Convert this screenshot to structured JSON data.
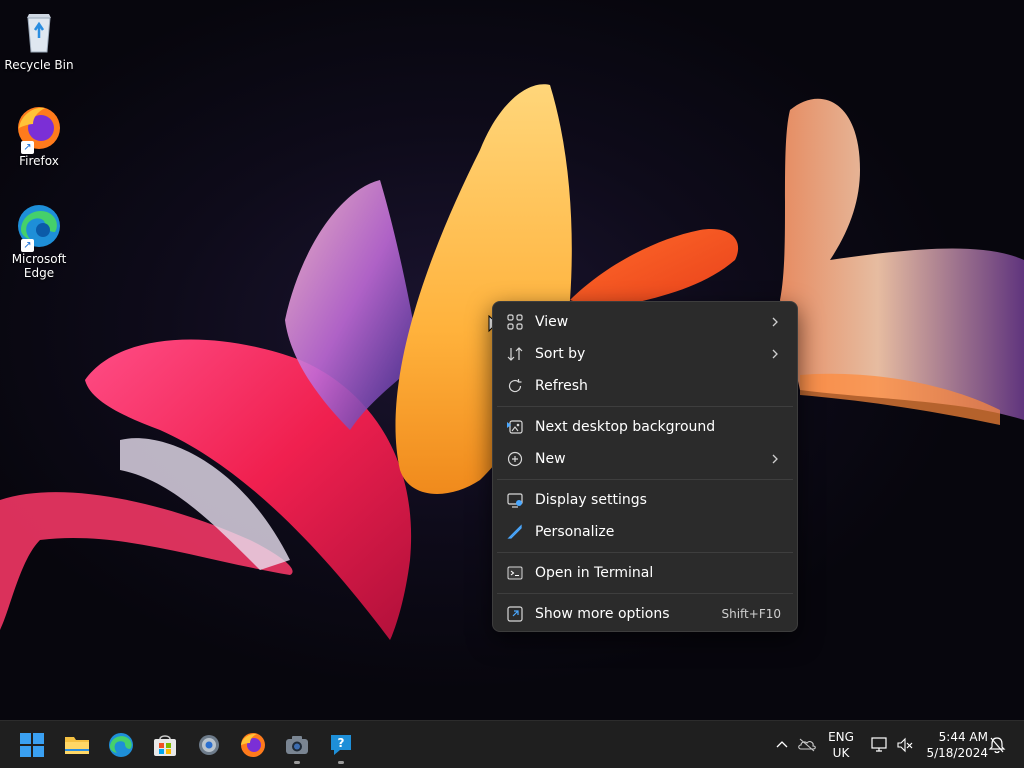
{
  "desktop": {
    "icons": [
      {
        "label": "Recycle Bin",
        "icon": "recycle-bin-icon"
      },
      {
        "label": "Firefox",
        "icon": "firefox-icon"
      },
      {
        "label": "Microsoft Edge",
        "icon": "edge-icon"
      }
    ]
  },
  "context_menu": {
    "groups": [
      [
        {
          "label": "View",
          "icon": "grid-view-icon",
          "submenu": true
        },
        {
          "label": "Sort by",
          "icon": "sort-icon",
          "submenu": true
        },
        {
          "label": "Refresh",
          "icon": "refresh-icon",
          "submenu": false
        }
      ],
      [
        {
          "label": "Next desktop background",
          "icon": "next-background-icon",
          "submenu": false
        },
        {
          "label": "New",
          "icon": "new-plus-icon",
          "submenu": true
        }
      ],
      [
        {
          "label": "Display settings",
          "icon": "display-settings-icon",
          "submenu": false
        },
        {
          "label": "Personalize",
          "icon": "brush-icon",
          "submenu": false
        }
      ],
      [
        {
          "label": "Open in Terminal",
          "icon": "terminal-icon",
          "submenu": false
        }
      ],
      [
        {
          "label": "Show more options",
          "icon": "more-options-icon",
          "submenu": false,
          "shortcut": "Shift+F10"
        }
      ]
    ]
  },
  "taskbar": {
    "apps": [
      {
        "name": "Start",
        "icon": "windows-start-icon"
      },
      {
        "name": "File Explorer",
        "icon": "folder-icon"
      },
      {
        "name": "Microsoft Edge",
        "icon": "edge-icon"
      },
      {
        "name": "Microsoft Store",
        "icon": "store-icon"
      },
      {
        "name": "Settings",
        "icon": "gear-icon"
      },
      {
        "name": "Firefox",
        "icon": "firefox-icon"
      },
      {
        "name": "Camera",
        "icon": "camera-icon",
        "running": true
      },
      {
        "name": "Get Help",
        "icon": "help-icon",
        "running": true
      }
    ],
    "tray": {
      "language": "ENG",
      "region": "UK",
      "time": "5:44 AM",
      "date": "5/18/2024"
    }
  },
  "colors": {
    "menu_bg": "#2b2b2b",
    "taskbar_bg": "#1f1f1f",
    "accent": "#0078d4"
  }
}
